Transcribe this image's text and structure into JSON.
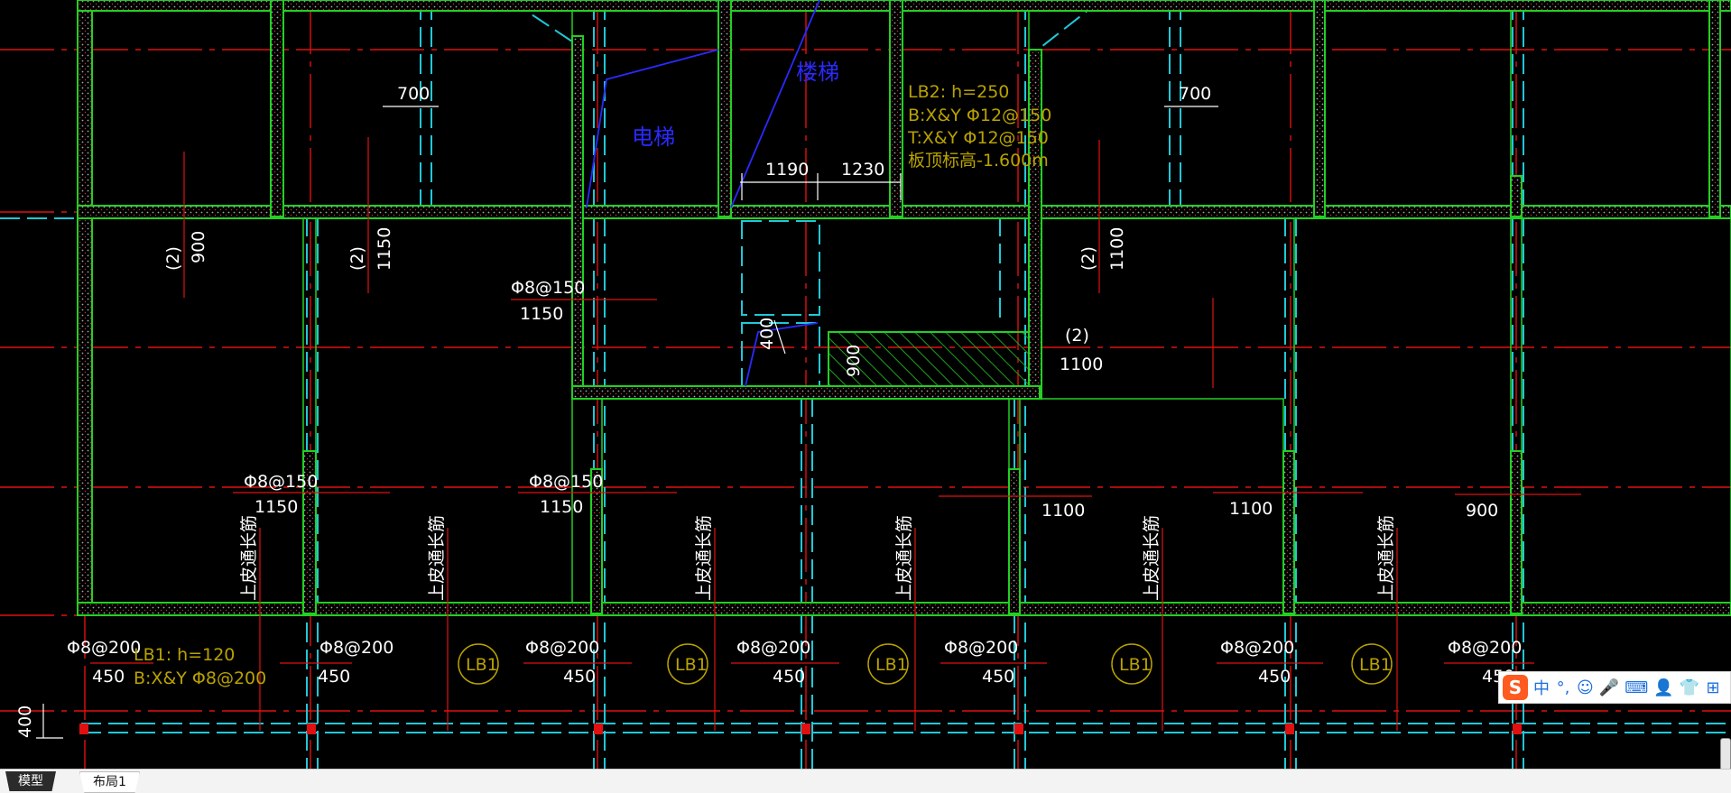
{
  "drawing": {
    "top_labels": [
      "电梯",
      "楼梯"
    ],
    "dims_top": [
      "700",
      "700",
      "1190",
      "1230"
    ],
    "lb2_lines": [
      "LB2: h=250",
      "B:X&Y Φ12@150",
      "T:X&Y Φ12@150",
      "板顶标高-1.600m"
    ],
    "rebar_mid": [
      "Φ8@150",
      "1150"
    ],
    "vert_labels": [
      {
        "top": "(2)",
        "bot": "900"
      },
      {
        "top": "(2)",
        "bot": "1150"
      },
      {
        "top": "(2)",
        "bot": "1100"
      }
    ],
    "dim_400_mid": "400",
    "dim_900_hatch": "900",
    "right_mid": [
      "(2)",
      "1100"
    ],
    "rebar_row2": [
      {
        "top": "Φ8@150",
        "bot": "1150"
      },
      {
        "top": "Φ8@150",
        "bot": "1150"
      },
      {
        "top": "",
        "bot": "1100"
      },
      {
        "top": "",
        "bot": "1100"
      },
      {
        "top": "",
        "bot": "900"
      }
    ],
    "vertical_note": "上皮通长筋",
    "rebar_bottom": [
      {
        "top": "Φ8@200",
        "bot": "450"
      },
      {
        "top": "Φ8@200",
        "bot": "450"
      },
      {
        "top": "Φ8@200",
        "bot": "450"
      },
      {
        "top": "Φ8@200",
        "bot": "450"
      },
      {
        "top": "Φ8@200",
        "bot": "450"
      },
      {
        "top": "Φ8@200",
        "bot": "450"
      },
      {
        "top": "Φ8@200",
        "bot": "450"
      }
    ],
    "lb1_lines": [
      "LB1: h=120",
      "B:X&Y Φ8@200"
    ],
    "lb1_tag": "LB1",
    "dim_400_left": "400"
  },
  "tabs": [
    {
      "label": "模型",
      "active": true
    },
    {
      "label": "布局1",
      "active": false
    }
  ],
  "ime_toolbar": {
    "logo": "S",
    "items": [
      "中",
      "°,",
      "☺",
      "🎤",
      "⌨",
      "👤",
      "👕",
      "⊞"
    ]
  },
  "colors": {
    "wall_green": "#22d022",
    "axis_red": "#e01010",
    "beam_cyan": "#20c8d8",
    "text_white": "#ffffff",
    "text_yellow": "#b9a200",
    "text_blue": "#2a2aff"
  }
}
